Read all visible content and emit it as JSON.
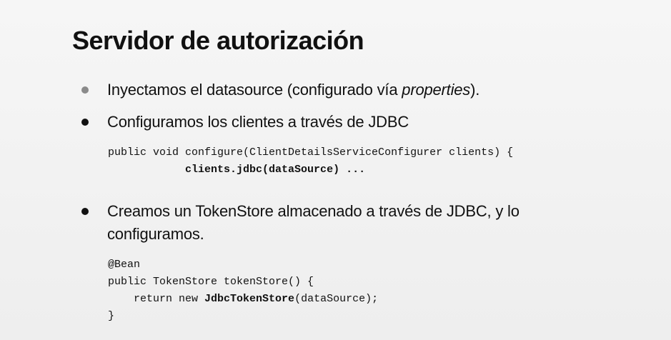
{
  "slide": {
    "title": "Servidor de autorización",
    "bullets": [
      {
        "text_before": "Inyectamos el datasource (configurado vía ",
        "text_italic": "properties",
        "text_after": ")."
      },
      {
        "text": "Configuramos los clientes a través de JDBC"
      },
      {
        "text_line1": "Creamos un TokenStore almacenado a través de JDBC, y lo",
        "text_line2": "configuramos."
      }
    ],
    "code_block_1": {
      "line1": "public void configure(ClientDetailsServiceConfigurer clients) {",
      "line2_indent": "            ",
      "line2_bold": "clients.jdbc(dataSource) ..."
    },
    "code_block_2": {
      "line1": "@Bean",
      "line2": "public TokenStore tokenStore() {",
      "line3_prefix": "    return new ",
      "line3_bold": "JdbcTokenStore",
      "line3_suffix": "(dataSource);",
      "line4": "}"
    }
  }
}
